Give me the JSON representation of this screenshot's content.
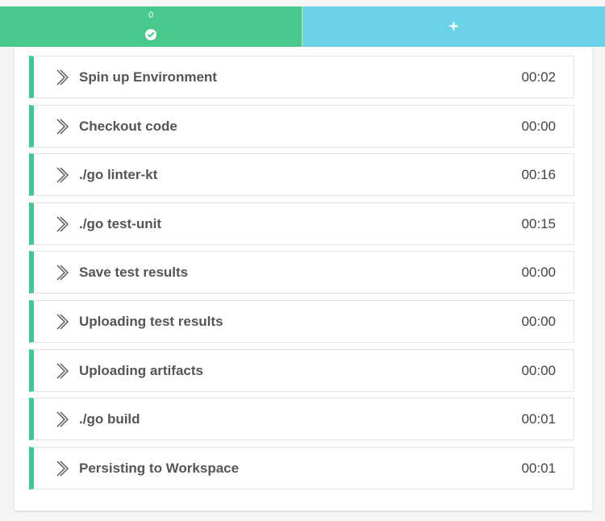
{
  "colors": {
    "success_green": "#48c98b",
    "add_tab_blue": "#6ad2e6",
    "step_border_green": "#42c88a",
    "text_dark": "#555555"
  },
  "tabs": {
    "container": {
      "index": "0",
      "status_icon": "check-circle-icon",
      "status": "success"
    },
    "add": {
      "label": "+"
    }
  },
  "steps": [
    {
      "name": "Spin up Environment",
      "time": "00:02"
    },
    {
      "name": "Checkout code",
      "time": "00:00"
    },
    {
      "name": "./go linter-kt",
      "time": "00:16"
    },
    {
      "name": "./go test-unit",
      "time": "00:15"
    },
    {
      "name": "Save test results",
      "time": "00:00"
    },
    {
      "name": "Uploading test results",
      "time": "00:00"
    },
    {
      "name": "Uploading artifacts",
      "time": "00:00"
    },
    {
      "name": "./go build",
      "time": "00:01"
    },
    {
      "name": "Persisting to Workspace",
      "time": "00:01"
    }
  ],
  "step_icon": "chevron-right-icon"
}
